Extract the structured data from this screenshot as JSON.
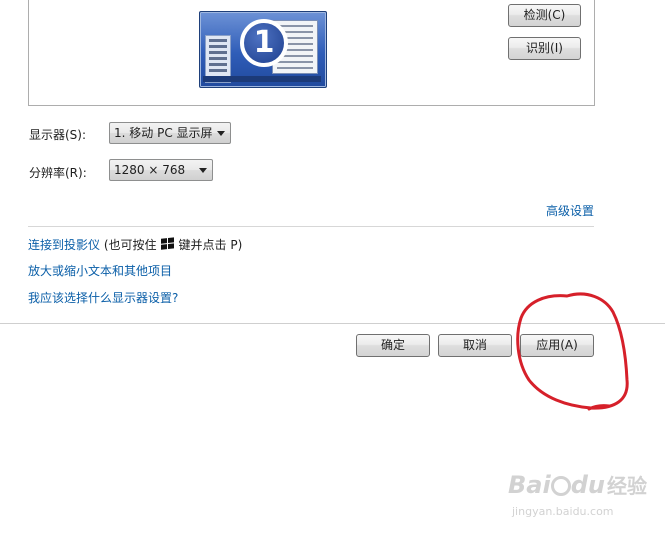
{
  "preview": {
    "monitor_number": "1",
    "buttons": {
      "detect": "检测(C)",
      "identify": "识别(I)"
    }
  },
  "display": {
    "label": "显示器(S):",
    "selected": "1. 移动 PC 显示屏"
  },
  "resolution": {
    "label": "分辨率(R):",
    "selected": "1280 × 768"
  },
  "advanced_link": "高级设置",
  "projector": {
    "link": "连接到投影仪",
    "note_prefix": "(也可按住",
    "note_suffix": "键并点击 P)"
  },
  "links": {
    "text_size": "放大或缩小文本和其他项目",
    "which_settings": "我应该选择什么显示器设置?"
  },
  "footer": {
    "ok": "确定",
    "cancel": "取消",
    "apply": "应用(A)"
  },
  "annotation": {
    "color": "#d6202a"
  },
  "watermark": {
    "brand": "Bai",
    "brand_tail": "du",
    "product": "经验",
    "url": "jingyan.baidu.com"
  }
}
